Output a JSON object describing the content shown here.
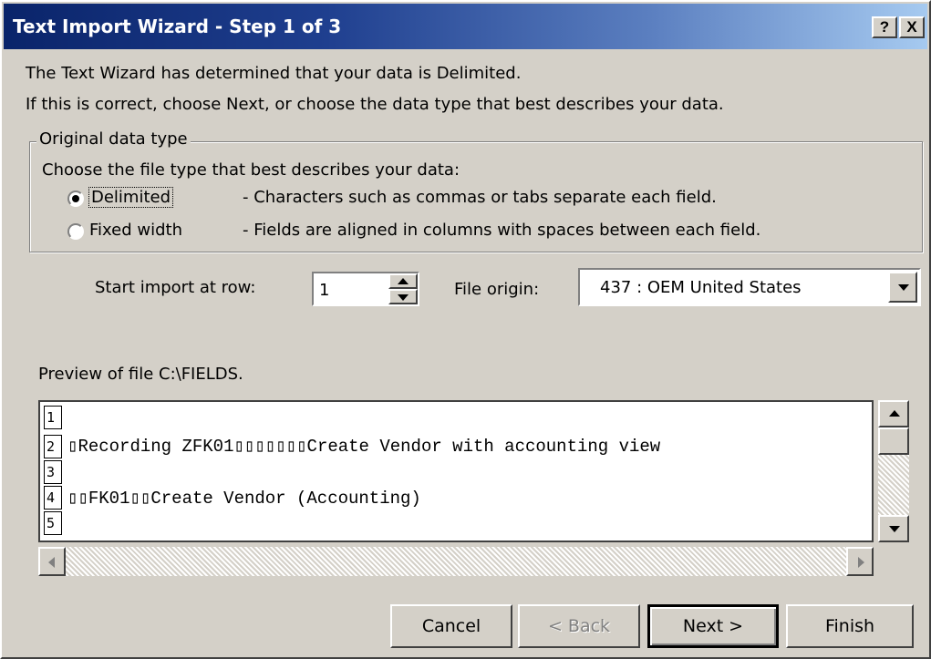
{
  "window": {
    "title": "Text Import Wizard - Step 1 of 3",
    "help_label": "?",
    "close_label": "X"
  },
  "intro": {
    "line1": "The Text Wizard has determined that your data is Delimited.",
    "line2": "If this is correct, choose Next, or choose the data type that best describes your data."
  },
  "original_data_type": {
    "legend": "Original data type",
    "prompt": "Choose the file type that best describes your data:",
    "options": [
      {
        "label": "Delimited",
        "description": "- Characters such as commas or tabs separate each field.",
        "selected": true
      },
      {
        "label": "Fixed width",
        "description": "- Fields are aligned in columns with spaces between each field.",
        "selected": false
      }
    ]
  },
  "start_row": {
    "label": "Start import at row:",
    "value": "1"
  },
  "file_origin": {
    "label": "File origin:",
    "value": "437 : OEM United States"
  },
  "preview": {
    "label": "Preview of file C:\\FIELDS.",
    "rows": [
      {
        "num": "1",
        "text": ""
      },
      {
        "num": "2",
        "text": "▯Recording ZFK01▯▯▯▯▯▯▯Create Vendor with accounting view"
      },
      {
        "num": "3",
        "text": ""
      },
      {
        "num": "4",
        "text": "▯▯FK01▯▯Create Vendor (Accounting)"
      },
      {
        "num": "5",
        "text": ""
      }
    ]
  },
  "buttons": {
    "cancel": "Cancel",
    "back": "< Back",
    "next": "Next >",
    "finish": "Finish"
  }
}
